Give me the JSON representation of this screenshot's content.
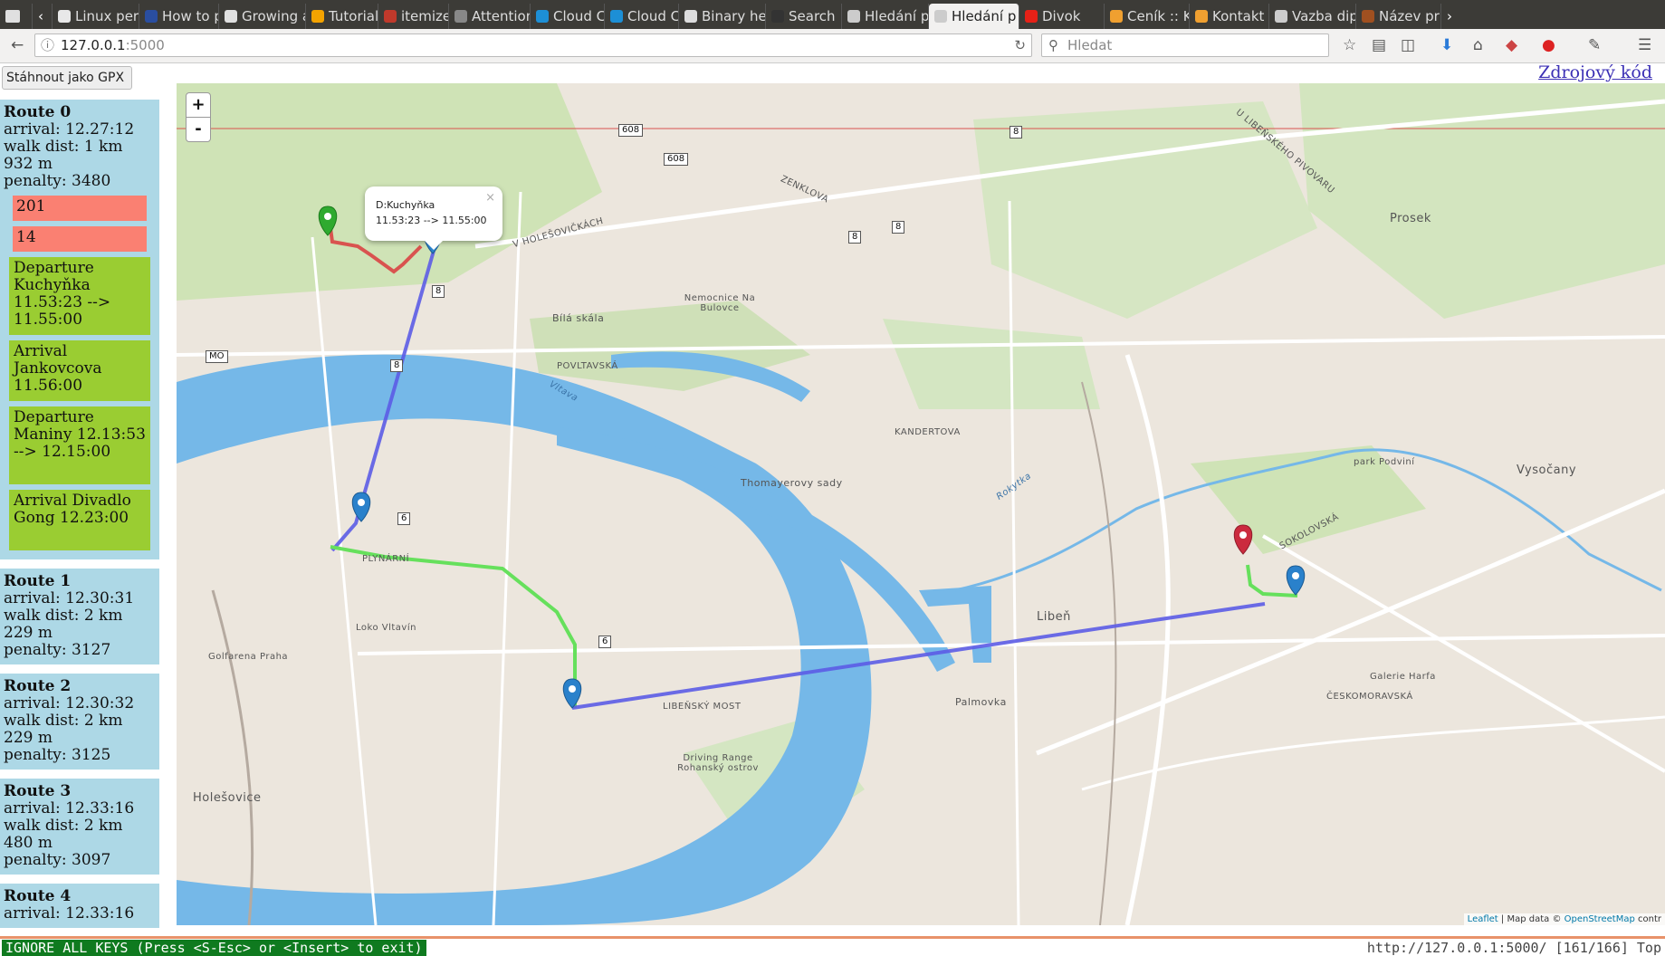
{
  "browser": {
    "tabs": [
      {
        "label": "Linux perf E",
        "color": "#e8e8e8"
      },
      {
        "label": "How to p",
        "color": "#2a4ea0"
      },
      {
        "label": "Growing arr",
        "color": "#e0e0e0"
      },
      {
        "label": "Tutorial",
        "color": "#f4a300"
      },
      {
        "label": "itemize",
        "color": "#c0392b"
      },
      {
        "label": "Attention",
        "color": "#888888"
      },
      {
        "label": "Cloud Cc",
        "color": "#1d8fd6"
      },
      {
        "label": "Cloud Cc",
        "color": "#1d8fd6"
      },
      {
        "label": "Binary heap",
        "color": "#dddddd"
      },
      {
        "label": "Search",
        "color": "#333333"
      },
      {
        "label": "Hledání pěš",
        "color": "#cccccc"
      },
      {
        "label": "Hledání p",
        "color": "#cccccc",
        "active": true
      },
      {
        "label": "Divok",
        "color": "#e62117"
      },
      {
        "label": "Ceník :: K",
        "color": "#f0a030"
      },
      {
        "label": "Kontakt",
        "color": "#f0a030"
      },
      {
        "label": "Vazba diplo",
        "color": "#cccccc"
      },
      {
        "label": "Název pr",
        "color": "#a05020"
      }
    ],
    "url_host": "127.0.0.1",
    "url_port": ":5000",
    "search_placeholder": "Hledat"
  },
  "page": {
    "gpx_button": "Stáhnout jako GPX",
    "source_link": "Zdrojový kód"
  },
  "routes": [
    {
      "title": "Route 0",
      "arrival": "arrival: 12.27:12",
      "walk": "walk dist: 1 km 932 m",
      "penalty": "penalty: 3480",
      "warnings": [
        "201",
        "14"
      ],
      "steps": [
        "Departure Kuchyňka 11.53:23 --> 11.55:00",
        "Arrival Jankovcova 11.56:00",
        "Departure Maniny 12.13:53 --> 12.15:00",
        "Arrival Divadlo Gong 12.23:00"
      ]
    },
    {
      "title": "Route 1",
      "arrival": "arrival: 12.30:31",
      "walk": "walk dist: 2 km 229 m",
      "penalty": "penalty: 3127"
    },
    {
      "title": "Route 2",
      "arrival": "arrival: 12.30:32",
      "walk": "walk dist: 2 km 229 m",
      "penalty": "penalty: 3125"
    },
    {
      "title": "Route 3",
      "arrival": "arrival: 12.33:16",
      "walk": "walk dist: 2 km 480 m",
      "penalty": "penalty: 3097"
    },
    {
      "title": "Route 4",
      "arrival": "arrival: 12.33:16"
    }
  ],
  "map": {
    "zoom_in": "+",
    "zoom_out": "-",
    "popup_title": "D:Kuchyňka",
    "popup_time": "11.53:23 --> 11.55:00",
    "popup_close": "×",
    "attribution_leaflet": "Leaflet",
    "attribution_text": " | Map data © ",
    "attribution_osm": "OpenStreetMap",
    "attribution_tail": " contr",
    "labels": [
      {
        "text": "Vltava"
      },
      {
        "text": "Bílá skála"
      },
      {
        "text": "Thomayerovy sady"
      },
      {
        "text": "Libeň"
      },
      {
        "text": "Vysočany"
      },
      {
        "text": "Holešovice"
      },
      {
        "text": "Prosek"
      },
      {
        "text": "Palmovka"
      },
      {
        "text": "Nemocnice Na Bulovce"
      },
      {
        "text": "POVLTAVSKÁ"
      },
      {
        "text": "LIBEŇSKÝ MOST"
      },
      {
        "text": "SOKOLOVSKÁ"
      },
      {
        "text": "KANDERTOVA"
      },
      {
        "text": "ČESKOMORAVSKÁ"
      },
      {
        "text": "Galerie Harfa"
      },
      {
        "text": "Driving Range Rohanský ostrov"
      },
      {
        "text": "park Podviní"
      },
      {
        "text": "Golfarena Praha"
      },
      {
        "text": "Loko Vltavín"
      },
      {
        "text": "V HOLEŠOVIČKÁCH"
      },
      {
        "text": "ZENKLOVA"
      },
      {
        "text": "Rokytka"
      },
      {
        "text": "PLYNÁRNÍ"
      },
      {
        "text": "U LIBEŇSKÉHO PIVOVARU"
      }
    ],
    "shields": [
      {
        "text": "608"
      },
      {
        "text": "608"
      },
      {
        "text": "8"
      },
      {
        "text": "8"
      },
      {
        "text": "8"
      },
      {
        "text": "8"
      },
      {
        "text": "8"
      },
      {
        "text": "MO"
      },
      {
        "text": "6"
      },
      {
        "text": "6"
      }
    ]
  },
  "statusbar": {
    "mode": "IGNORE ALL KEYS (Press <S-Esc> or <Insert> to exit)",
    "url": "http://127.0.0.1:5000/ [161/166] Top"
  },
  "colors": {
    "route_bg": "#add8e6",
    "warning": "#fa8072",
    "step": "#9acd32",
    "water": "#75b8e8",
    "transit_line": "#5c5ce6",
    "walk_line": "#66e05c"
  }
}
